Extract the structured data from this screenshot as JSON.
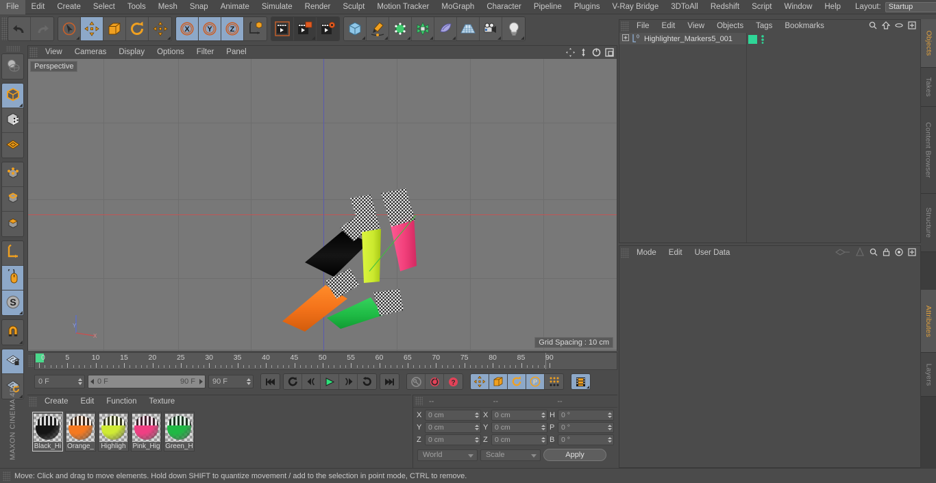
{
  "app": {
    "name": "CINEMA 4D",
    "brand": "MAXON CINEMA 4D"
  },
  "menubar": {
    "items": [
      {
        "label": "File"
      },
      {
        "label": "Edit"
      },
      {
        "label": "Create"
      },
      {
        "label": "Select"
      },
      {
        "label": "Tools"
      },
      {
        "label": "Mesh"
      },
      {
        "label": "Snap"
      },
      {
        "label": "Animate"
      },
      {
        "label": "Simulate"
      },
      {
        "label": "Render"
      },
      {
        "label": "Sculpt"
      },
      {
        "label": "Motion Tracker"
      },
      {
        "label": "MoGraph"
      },
      {
        "label": "Character"
      },
      {
        "label": "Pipeline"
      },
      {
        "label": "Plugins"
      },
      {
        "label": "V-Ray Bridge"
      },
      {
        "label": "3DToAll"
      },
      {
        "label": "Redshift"
      },
      {
        "label": "Script"
      },
      {
        "label": "Window"
      },
      {
        "label": "Help"
      }
    ],
    "layout_label": "Layout:",
    "layout_value": "Startup",
    "search_icon": "search-icon"
  },
  "toolbar": {
    "groups": [
      {
        "name": "history",
        "buttons": [
          {
            "name": "undo-button",
            "icon": "undo-icon",
            "active": false,
            "corner": false
          },
          {
            "name": "redo-button",
            "icon": "redo-icon",
            "active": false,
            "corner": false
          }
        ]
      },
      {
        "name": "transform-tools",
        "buttons": [
          {
            "name": "select-tool",
            "icon": "cursor-select-icon",
            "active": false,
            "corner": true
          },
          {
            "name": "move-tool",
            "icon": "move-icon",
            "active": true,
            "corner": false
          },
          {
            "name": "scale-tool",
            "icon": "scale-icon",
            "active": false,
            "corner": false
          },
          {
            "name": "rotate-tool",
            "icon": "rotate-icon",
            "active": false,
            "corner": false
          },
          {
            "name": "dynamic-place-tool",
            "icon": "move-icon",
            "active": false,
            "corner": true
          }
        ]
      },
      {
        "name": "axis-locks",
        "buttons": [
          {
            "name": "lock-x-axis",
            "icon": "x-axis-icon",
            "active": true,
            "corner": false
          },
          {
            "name": "lock-y-axis",
            "icon": "y-axis-icon",
            "active": true,
            "corner": false
          },
          {
            "name": "lock-z-axis",
            "icon": "z-axis-icon",
            "active": true,
            "corner": false
          },
          {
            "name": "world-object-axis",
            "icon": "world-axis-icon",
            "active": false,
            "corner": false
          }
        ]
      },
      {
        "name": "render-tools",
        "buttons": [
          {
            "name": "render-view-button",
            "icon": "render-view-icon",
            "active": false,
            "corner": false
          },
          {
            "name": "render-region-button",
            "icon": "render-region-icon",
            "active": false,
            "corner": true
          },
          {
            "name": "render-settings-button",
            "icon": "render-settings-icon",
            "active": false,
            "corner": false
          }
        ]
      },
      {
        "name": "create-objects",
        "buttons": [
          {
            "name": "add-cube-button",
            "icon": "cube-icon",
            "active": false,
            "corner": true
          },
          {
            "name": "add-spline-button",
            "icon": "pen-spline-icon",
            "active": false,
            "corner": true
          },
          {
            "name": "add-generator-button",
            "icon": "generator-icon",
            "active": false,
            "corner": true
          },
          {
            "name": "add-deformer-button",
            "icon": "deformer-icon",
            "active": false,
            "corner": true
          },
          {
            "name": "add-scene-button",
            "icon": "environment-icon",
            "active": false,
            "corner": true
          },
          {
            "name": "add-floor-button",
            "icon": "floor-grid-icon",
            "active": false,
            "corner": false
          },
          {
            "name": "add-camera-button",
            "icon": "camera-icon",
            "active": false,
            "corner": true
          },
          {
            "name": "add-light-button",
            "icon": "light-bulb-icon",
            "active": false,
            "corner": true
          }
        ]
      }
    ]
  },
  "left_toolbar": {
    "groups": [
      {
        "name": "render-queue",
        "buttons": [
          {
            "name": "render-queue-button",
            "icon": "globe-render-icon",
            "active": false,
            "corner": false
          }
        ]
      },
      {
        "name": "edit-modes",
        "buttons": [
          {
            "name": "model-mode-button",
            "icon": "model-cube-icon",
            "active": true,
            "corner": true
          },
          {
            "name": "texture-mode-button",
            "icon": "texture-cube-icon",
            "active": false,
            "corner": false
          },
          {
            "name": "uv-mesh-mode-button",
            "icon": "uv-mesh-icon",
            "active": false,
            "corner": false
          }
        ]
      },
      {
        "name": "component-modes",
        "buttons": [
          {
            "name": "points-mode-button",
            "icon": "points-cube-icon",
            "active": false,
            "corner": false
          },
          {
            "name": "edges-mode-button",
            "icon": "edges-cube-icon",
            "active": false,
            "corner": false
          },
          {
            "name": "polygons-mode-button",
            "icon": "polygons-cube-icon",
            "active": false,
            "corner": false
          }
        ]
      },
      {
        "name": "axis-tools",
        "buttons": [
          {
            "name": "enable-axis-button",
            "icon": "axis-icon",
            "active": false,
            "corner": false
          },
          {
            "name": "viewport-solo-button",
            "icon": "mouse-icon",
            "active": true,
            "corner": false
          },
          {
            "name": "enable-snap-button",
            "icon": "snap-s-icon",
            "active": true,
            "corner": true
          }
        ]
      },
      {
        "name": "magnet",
        "buttons": [
          {
            "name": "magnet-tool-button",
            "icon": "magnet-icon",
            "active": false,
            "corner": true
          }
        ]
      },
      {
        "name": "workplane",
        "buttons": [
          {
            "name": "workplane-lock-button",
            "icon": "workplane-lock-icon",
            "active": true,
            "corner": false
          },
          {
            "name": "workplane-rotate-button",
            "icon": "workplane-rotate-icon",
            "active": false,
            "corner": true
          }
        ]
      }
    ]
  },
  "viewport": {
    "menu": [
      {
        "label": "View"
      },
      {
        "label": "Cameras"
      },
      {
        "label": "Display"
      },
      {
        "label": "Options"
      },
      {
        "label": "Filter"
      },
      {
        "label": "Panel"
      }
    ],
    "nav_icons": [
      {
        "name": "pan-view-icon"
      },
      {
        "name": "dolly-view-icon"
      },
      {
        "name": "rotate-view-icon"
      },
      {
        "name": "maximize-view-icon"
      }
    ],
    "label": "Perspective",
    "grid_spacing": "Grid Spacing : 10 cm",
    "axis_labels": {
      "y": "Y",
      "x": "X"
    },
    "scene_objects": [
      {
        "name": "black-highlighter",
        "color": "#111111"
      },
      {
        "name": "orange-highlighter",
        "color": "#f57920"
      },
      {
        "name": "yellow-highlighter",
        "color": "#ccec32"
      },
      {
        "name": "pink-highlighter",
        "color": "#f2467f"
      },
      {
        "name": "green-highlighter",
        "color": "#22c04b"
      }
    ]
  },
  "timeline": {
    "ticks": [
      0,
      5,
      10,
      15,
      20,
      25,
      30,
      35,
      40,
      45,
      50,
      55,
      60,
      65,
      70,
      75,
      80,
      85,
      90
    ],
    "current_frame": "0 F",
    "range_start": "0 F",
    "range_end": "90 F",
    "end_frame": "90 F",
    "preview_frame": "0 F",
    "controls": [
      {
        "name": "go-to-start-button",
        "icon": "skip-start-icon",
        "active": false
      },
      {
        "name": "play-backwards-button",
        "icon": "rewind-loop-icon",
        "active": false
      },
      {
        "name": "previous-frame-button",
        "icon": "step-back-icon",
        "active": false
      },
      {
        "name": "play-button",
        "icon": "play-icon",
        "active": false
      },
      {
        "name": "next-frame-button",
        "icon": "step-forward-icon",
        "active": false
      },
      {
        "name": "loop-button",
        "icon": "loop-icon",
        "active": false
      },
      {
        "name": "go-to-end-button",
        "icon": "skip-end-icon",
        "active": false
      }
    ],
    "record_controls": [
      {
        "name": "autokey-button",
        "icon": "key-icon",
        "active": false
      },
      {
        "name": "record-active-objects-button",
        "icon": "record-icon",
        "active": false
      },
      {
        "name": "autokeying-button",
        "icon": "question-record-icon",
        "active": false
      }
    ],
    "key_filters": [
      {
        "name": "position-key-button",
        "icon": "move-icon",
        "active": true
      },
      {
        "name": "scale-key-button",
        "icon": "scale-icon",
        "active": true
      },
      {
        "name": "rotation-key-button",
        "icon": "rotate-icon",
        "active": true
      },
      {
        "name": "param-key-button",
        "icon": "parameter-p-icon",
        "active": true
      },
      {
        "name": "pla-key-button",
        "icon": "point-level-anim-icon",
        "active": false
      }
    ],
    "timeline_toggle": {
      "name": "timeline-mode-button",
      "icon": "film-strip-icon",
      "active": true
    }
  },
  "material_manager": {
    "menu": [
      {
        "label": "Create"
      },
      {
        "label": "Edit"
      },
      {
        "label": "Function"
      },
      {
        "label": "Texture"
      }
    ],
    "materials": [
      {
        "name": "Black_Hi",
        "color": "#141414",
        "selected": true
      },
      {
        "name": "Orange_",
        "color": "#f57920",
        "selected": false
      },
      {
        "name": "Highligh",
        "color": "#cfeb34",
        "selected": false
      },
      {
        "name": "Pink_Hig",
        "color": "#ef3f83",
        "selected": false
      },
      {
        "name": "Green_H",
        "color": "#1fb944",
        "selected": false
      }
    ]
  },
  "coordinates": {
    "headers": [
      "--",
      "--",
      "--"
    ],
    "rows": [
      {
        "pos_label": "X",
        "pos_value": "0 cm",
        "size_label": "X",
        "size_value": "0 cm",
        "rot_label": "H",
        "rot_value": "0 °"
      },
      {
        "pos_label": "Y",
        "pos_value": "0 cm",
        "size_label": "Y",
        "size_value": "0 cm",
        "rot_label": "P",
        "rot_value": "0 °"
      },
      {
        "pos_label": "Z",
        "pos_value": "0 cm",
        "size_label": "Z",
        "size_value": "0 cm",
        "rot_label": "B",
        "rot_value": "0 °"
      }
    ],
    "coord_system": "World",
    "transform_mode": "Scale",
    "apply_label": "Apply"
  },
  "object_manager": {
    "menu": [
      {
        "label": "File"
      },
      {
        "label": "Edit"
      },
      {
        "label": "View"
      },
      {
        "label": "Objects"
      },
      {
        "label": "Tags"
      },
      {
        "label": "Bookmarks"
      }
    ],
    "icons": [
      {
        "name": "search-icon"
      },
      {
        "name": "home-icon"
      },
      {
        "name": "ellipse-icon"
      },
      {
        "name": "add-panel-icon"
      }
    ],
    "objects": [
      {
        "name": "Highlighter_Markers5_001",
        "tag_color": "#2fd697",
        "level": 0,
        "expandable": true
      }
    ]
  },
  "attribute_manager": {
    "menu": [
      {
        "label": "Mode"
      },
      {
        "label": "Edit"
      },
      {
        "label": "User Data"
      }
    ],
    "icons": [
      {
        "name": "interpolation-icon"
      },
      {
        "name": "cone-icon"
      },
      {
        "name": "search-icon"
      },
      {
        "name": "lock-icon"
      },
      {
        "name": "target-icon"
      },
      {
        "name": "add-panel-icon"
      }
    ]
  },
  "right_tabs": {
    "upper": [
      {
        "label": "Objects",
        "active": true
      },
      {
        "label": "Takes",
        "active": false
      },
      {
        "label": "Content Browser",
        "active": false
      },
      {
        "label": "Structure",
        "active": false
      }
    ],
    "lower": [
      {
        "label": "Attributes",
        "active": true
      },
      {
        "label": "Layers",
        "active": false
      }
    ]
  },
  "statusbar": {
    "message": "Move: Click and drag to move elements. Hold down SHIFT to quantize movement / add to the selection in point mode, CTRL to remove."
  }
}
